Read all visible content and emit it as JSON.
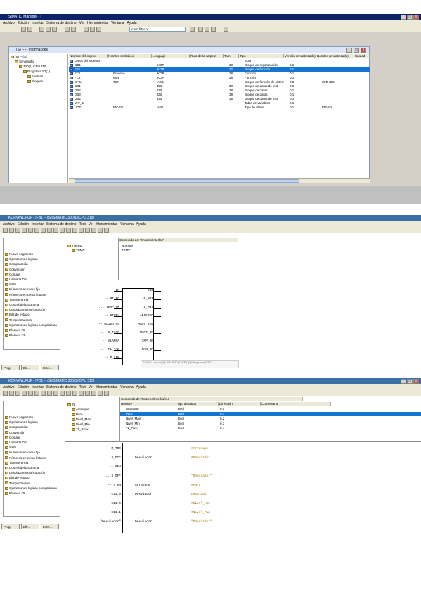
{
  "panel1": {
    "app_title": "SIMATIC Manager - [",
    "menu": [
      "Archivo",
      "Edición",
      "Insertar",
      "Sistema de destino",
      "Ver",
      "Herramientas",
      "Ventana",
      "Ayuda"
    ],
    "filter_value": "< sin filtro >",
    "inner_title": "(S) -- -- Informações",
    "tree": [
      "(S) -- (S)",
      "Simulação",
      "300(1) CPU 315",
      "Programa S7(1)",
      "Fuentes",
      "Bloques"
    ],
    "columns": [
      "Nombre del objeto",
      "Nombre simbólico",
      "Lenguaje",
      "Ruta de la carpeta",
      "Tam.",
      "Tipo",
      "Versión (encabezado)",
      "Nombre (encabezado)",
      "Unidad"
    ],
    "rows": [
      {
        "name": "Datos del sistema",
        "symbol": "",
        "lang": "",
        "size": "",
        "type": "SDB",
        "ver": "",
        "hname": ""
      },
      {
        "name": "OB1",
        "symbol": "",
        "lang": "KOP",
        "size": "38",
        "type": "Bloque de organización",
        "ver": "0.1",
        "hname": ""
      },
      {
        "name": "FB1",
        "symbol": "",
        "lang": "KOP",
        "size": "72",
        "type": "Bloque de función",
        "ver": "0.1",
        "hname": ""
      },
      {
        "name": "FC1",
        "symbol": "Proceso",
        "lang": "KOP",
        "size": "38",
        "type": "Función",
        "ver": "0.1",
        "hname": ""
      },
      {
        "name": "FC2",
        "symbol": "Mov",
        "lang": "KOP",
        "size": "38",
        "type": "Función",
        "ver": "0.1",
        "hname": ""
      },
      {
        "name": "SFB4",
        "symbol": "TON",
        "lang": "AWL",
        "size": "",
        "type": "Bloque de función de sistema",
        "ver": "0.0",
        "hname": "SFB-IEC",
        "unit": ""
      },
      {
        "name": "DB1",
        "symbol": "",
        "lang": "DB",
        "size": "38",
        "type": "Bloque de datos de inst.",
        "ver": "0.1",
        "hname": ""
      },
      {
        "name": "DB2",
        "symbol": "",
        "lang": "DB",
        "size": "38",
        "type": "Bloque de datos",
        "ver": "0.1",
        "hname": ""
      },
      {
        "name": "DB3",
        "symbol": "",
        "lang": "DB",
        "size": "38",
        "type": "Bloque de datos",
        "ver": "0.1",
        "hname": ""
      },
      {
        "name": "DB4",
        "symbol": "",
        "lang": "DB",
        "size": "38",
        "type": "Bloque de datos de inst.",
        "ver": "0.1",
        "hname": ""
      },
      {
        "name": "VAT_1",
        "symbol": "",
        "lang": "",
        "size": "",
        "type": "Tabla de variables",
        "ver": "0.1",
        "hname": ""
      },
      {
        "name": "UDT1",
        "symbol": "ENVIO",
        "lang": "AWL",
        "size": "",
        "type": "Tipo de datos",
        "ver": "0.1",
        "hname": "ENVIO"
      }
    ]
  },
  "panel2": {
    "app_title": "KOP/AWL/FUP - [FB1 -- (S)\\SIMATIC 300(1)\\CPU 315]",
    "menu": [
      "Archivo",
      "Edición",
      "Insertar",
      "Sistema de destino",
      "Test",
      "Ver",
      "Herramientas",
      "Ventana",
      "Ayuda"
    ],
    "catalog": [
      "Nuevo segmento",
      "Operaciones lógicas",
      "Comparación",
      "Conversión",
      "Contaje",
      "Llamada DB",
      "Salto",
      "Números en coma fija",
      "Números en coma flotante",
      "Transferencia",
      "Control del programa",
      "Desplazamiento/Rotación",
      "Bits de estado",
      "Temporizadores",
      "Operaciones lógicas con palabras",
      "Bloques FB",
      "Bloques FC"
    ],
    "tabs": [
      "Prog.",
      "Ele...",
      "Este..."
    ],
    "decl_tree": [
      "Interfaz",
      "TEMP"
    ],
    "decl_header": "Contenido de: 'Entorno\\Interfaz'",
    "decl_items": [
      "Nombre",
      "TEMP"
    ],
    "ladder_left": [
      "EN",
      "-- MT_RQ",
      "... TEMP_OK",
      "-- NIVEL",
      "-- RUIDO_MS",
      "... S_TIMP",
      "-- ALARMA",
      "... FL_TAB",
      "-- P_ARM"
    ],
    "ladder_right": [
      "ENO",
      "E_MNT",
      "S_MNT",
      "... ABIERTO",
      "MANT_VAL",
      "MANT_ON",
      "IMP_ON",
      "MAN_OP"
    ],
    "footer_note": "ENVIO-Lectura(1): SIMATIC(1)\\CPU(1)\\Programa S7(1)"
  },
  "panel3": {
    "app_title": "KOP/AWL/FUP - [FC1 -- (S)\\SIMATIC 300(1)\\CPU 315]",
    "menu": [
      "Archivo",
      "Edición",
      "Insertar",
      "Sistema de destino",
      "Test",
      "Ver",
      "Herramientas",
      "Ventana",
      "Ayuda"
    ],
    "catalog": [
      "Nuevo segmento",
      "Operaciones lógicas",
      "Comparación",
      "Conversión",
      "Contaje",
      "Llamada DB",
      "Salto",
      "Números en coma fija",
      "Números en coma flotante",
      "Transferencia",
      "Control del programa",
      "Desplazamiento/Rotación",
      "Bits de estado",
      "Temporización",
      "Operaciones lógicas con palabras",
      "Bloques FB"
    ],
    "tabs": [
      "Prog.",
      "Ele...",
      "Este..."
    ],
    "decl_header": "Contenido de: 'Entorno\\Interfaz\\IN'",
    "decl_tree": [
      "IN",
      "Arranque",
      "Paro",
      "Nivel_Max",
      "Nivel_Min",
      "Tk_Desv"
    ],
    "var_columns": [
      "Nombre",
      "Tipo de datos",
      "Dirección",
      "Comentario"
    ],
    "var_rows": [
      {
        "name": "Arranque",
        "type": "Bool",
        "addr": "0.0"
      },
      {
        "name": "Paro",
        "type": "Bool",
        "addr": "0.1"
      },
      {
        "name": "Nivel_Max",
        "type": "Bool",
        "addr": "0.2"
      },
      {
        "name": "Nivel_Min",
        "type": "Bool",
        "addr": "0.3"
      },
      {
        "name": "Tk_Desv",
        "type": "Bool",
        "addr": "0.4"
      }
    ],
    "ladder": [
      {
        "l": "-- M_TRD",
        "m": "",
        "r": "#Arranque"
      },
      {
        "l": "... S_OCC",
        "m": "Desviador",
        "r": "#Desviador"
      },
      {
        "l": "-- #FV",
        "m": "",
        "r": ""
      },
      {
        "l": "... S_OFF",
        "m": "",
        "r": "\"Desviador\""
      },
      {
        "l": "-- T_ON",
        "m": "Arranque",
        "r": "#Paro"
      },
      {
        "l": "E11.0",
        "m": "Desviador",
        "r": "Desviador"
      },
      {
        "l": "E11.0",
        "m": "",
        "r": "#Nivel_Max"
      },
      {
        "l": "E11.1",
        "m": "",
        "r": "#Nivel_Min"
      },
      {
        "l": "\"Desviador\"",
        "m": "Desviador",
        "r": "\"Desviador\""
      }
    ]
  }
}
